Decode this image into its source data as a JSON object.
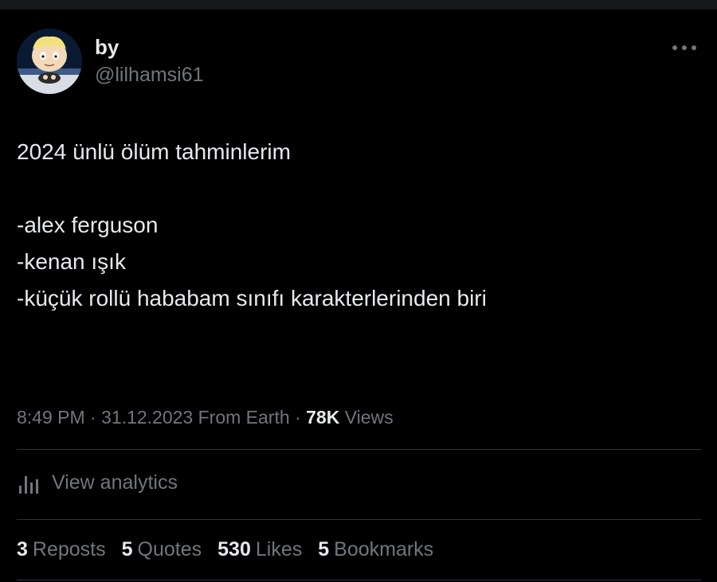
{
  "author": {
    "display_name": "by",
    "handle": "@lilhamsi61",
    "avatar_icon": "cartoon-avatar-icon"
  },
  "tweet": {
    "lines": [
      "2024 ünlü ölüm tahminlerim",
      "",
      "-alex ferguson",
      "-kenan ışık",
      "-küçük rollü hababam sınıfı karakterlerinden biri"
    ]
  },
  "meta": {
    "time": "8:49 PM",
    "sep1": "·",
    "date": "31.12.2023",
    "source": "From Earth",
    "sep2": "·",
    "views_count": "78K",
    "views_label": "Views"
  },
  "analytics": {
    "label": "View analytics",
    "icon": "bar-chart-icon"
  },
  "stats": {
    "reposts": {
      "count": "3",
      "label": "Reposts"
    },
    "quotes": {
      "count": "5",
      "label": "Quotes"
    },
    "likes": {
      "count": "530",
      "label": "Likes"
    },
    "bookmarks": {
      "count": "5",
      "label": "Bookmarks"
    }
  },
  "colors": {
    "background": "#000000",
    "text_primary": "#e7e9ea",
    "text_secondary": "#71767b",
    "divider": "#2f3336"
  }
}
